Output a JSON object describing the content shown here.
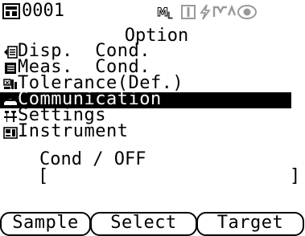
{
  "status": {
    "memory_number": "0001",
    "icons": [
      "memory-icon",
      "measurement-mode-icon",
      "target-icon",
      "battery-icon",
      "link-icon",
      "camera-icon"
    ]
  },
  "title": "Option",
  "menu": {
    "items": [
      {
        "label": "Disp.  Cond.",
        "icon": "display-icon",
        "selected": false
      },
      {
        "label": "Meas.  Cond.",
        "icon": "list-icon",
        "selected": false
      },
      {
        "label": "Tolerance(Def.)",
        "icon": "tolerance-icon",
        "selected": false
      },
      {
        "label": "Communication",
        "icon": "communication-icon",
        "selected": true
      },
      {
        "label": "Settings",
        "icon": "settings-icon",
        "selected": false
      },
      {
        "label": "Instrument",
        "icon": "instrument-icon",
        "selected": false
      }
    ]
  },
  "detail": {
    "cond_text": "Cond / OFF",
    "bracket_left": "[",
    "bracket_right": "]"
  },
  "softkeys": {
    "sample": "Sample",
    "select": "Select",
    "target": "Target"
  }
}
